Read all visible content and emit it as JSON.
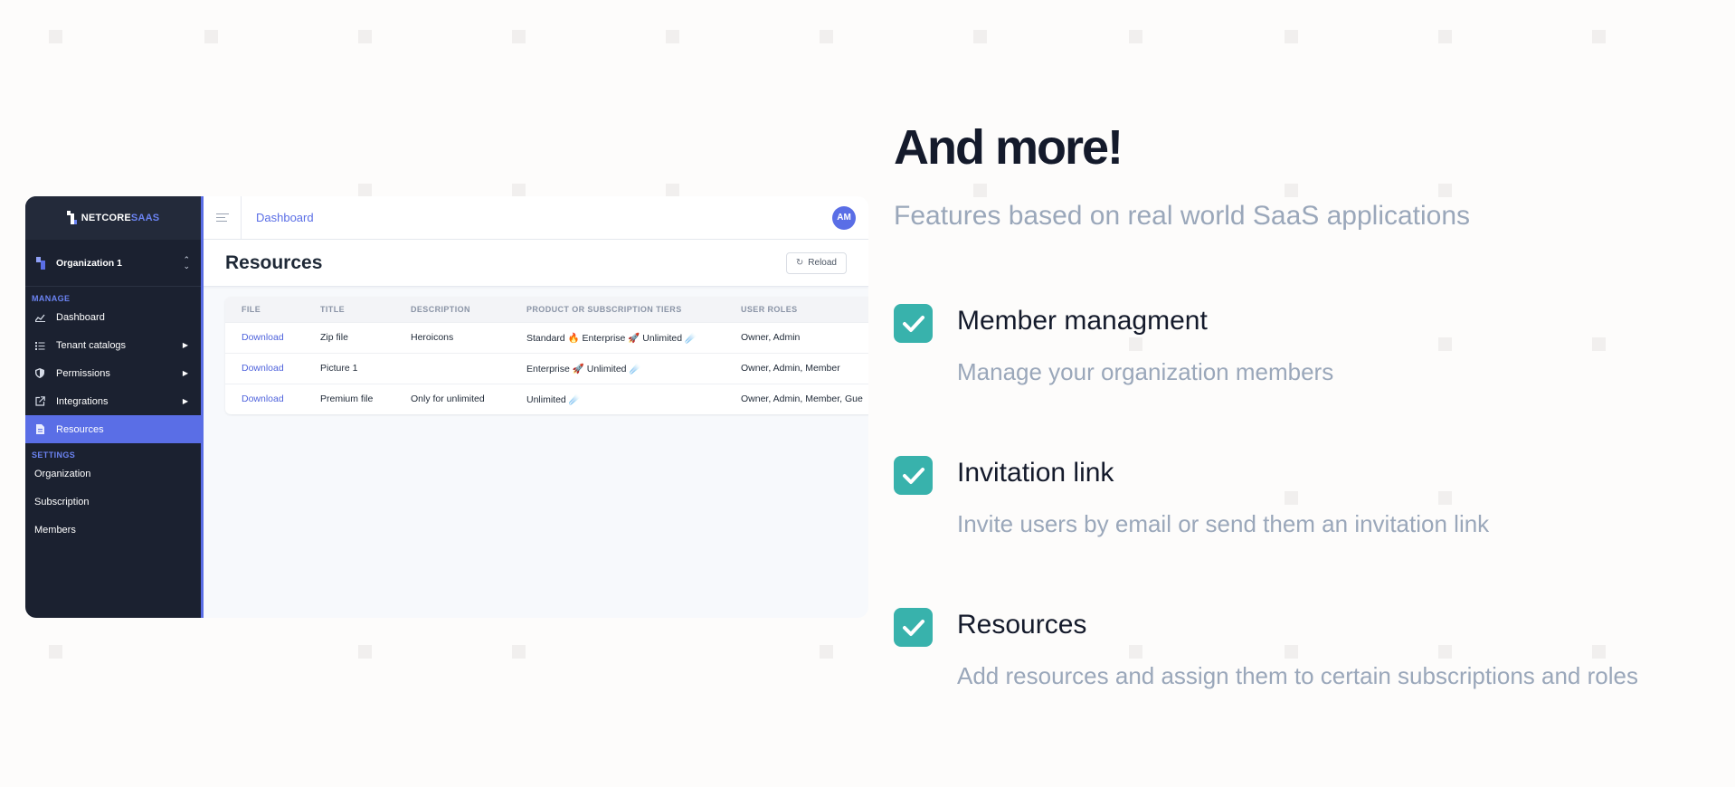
{
  "app": {
    "brand_main": "NETCORE",
    "brand_accent": "SAAS",
    "organization": "Organization 1",
    "sections": {
      "manage": "MANAGE",
      "settings": "SETTINGS"
    },
    "manage_items": [
      {
        "label": "Dashboard",
        "icon": "chart-icon",
        "expandable": false
      },
      {
        "label": "Tenant catalogs",
        "icon": "list-icon",
        "expandable": true
      },
      {
        "label": "Permissions",
        "icon": "shield-icon",
        "expandable": true
      },
      {
        "label": "Integrations",
        "icon": "external-link-icon",
        "expandable": true
      },
      {
        "label": "Resources",
        "icon": "document-icon",
        "expandable": false,
        "active": true
      }
    ],
    "settings_items": [
      "Organization",
      "Subscription",
      "Members"
    ],
    "breadcrumb": "Dashboard",
    "avatar": "AM",
    "page_title": "Resources",
    "reload_label": "Reload",
    "table": {
      "columns": [
        "FILE",
        "TITLE",
        "DESCRIPTION",
        "PRODUCT OR SUBSCRIPTION TIERS",
        "USER ROLES"
      ],
      "rows": [
        [
          "Download",
          "Zip file",
          "Heroicons",
          "Standard 🔥 Enterprise 🚀 Unlimited ☄️",
          "Owner, Admin"
        ],
        [
          "Download",
          "Picture 1",
          "",
          "Enterprise 🚀 Unlimited ☄️",
          "Owner, Admin, Member"
        ],
        [
          "Download",
          "Premium file",
          "Only for unlimited",
          "Unlimited ☄️",
          "Owner, Admin, Member, Gue"
        ]
      ]
    }
  },
  "marketing": {
    "headline": "And more!",
    "subhead": "Features based on real world SaaS applications",
    "features": [
      {
        "title": "Member managment",
        "description": "Manage your organization members",
        "icon": "check-icon"
      },
      {
        "title": "Invitation link",
        "description": "Invite users by email or send them an invitation link",
        "icon": "check-icon"
      },
      {
        "title": "Resources",
        "description": "Add resources and assign them to certain subscriptions and roles",
        "icon": "check-icon"
      }
    ]
  },
  "colors": {
    "accent": "#5a6ee6",
    "sidebar": "#1b2130",
    "check": "#38b2ac",
    "headline": "#141a2b",
    "muted": "#9aa7ba"
  }
}
